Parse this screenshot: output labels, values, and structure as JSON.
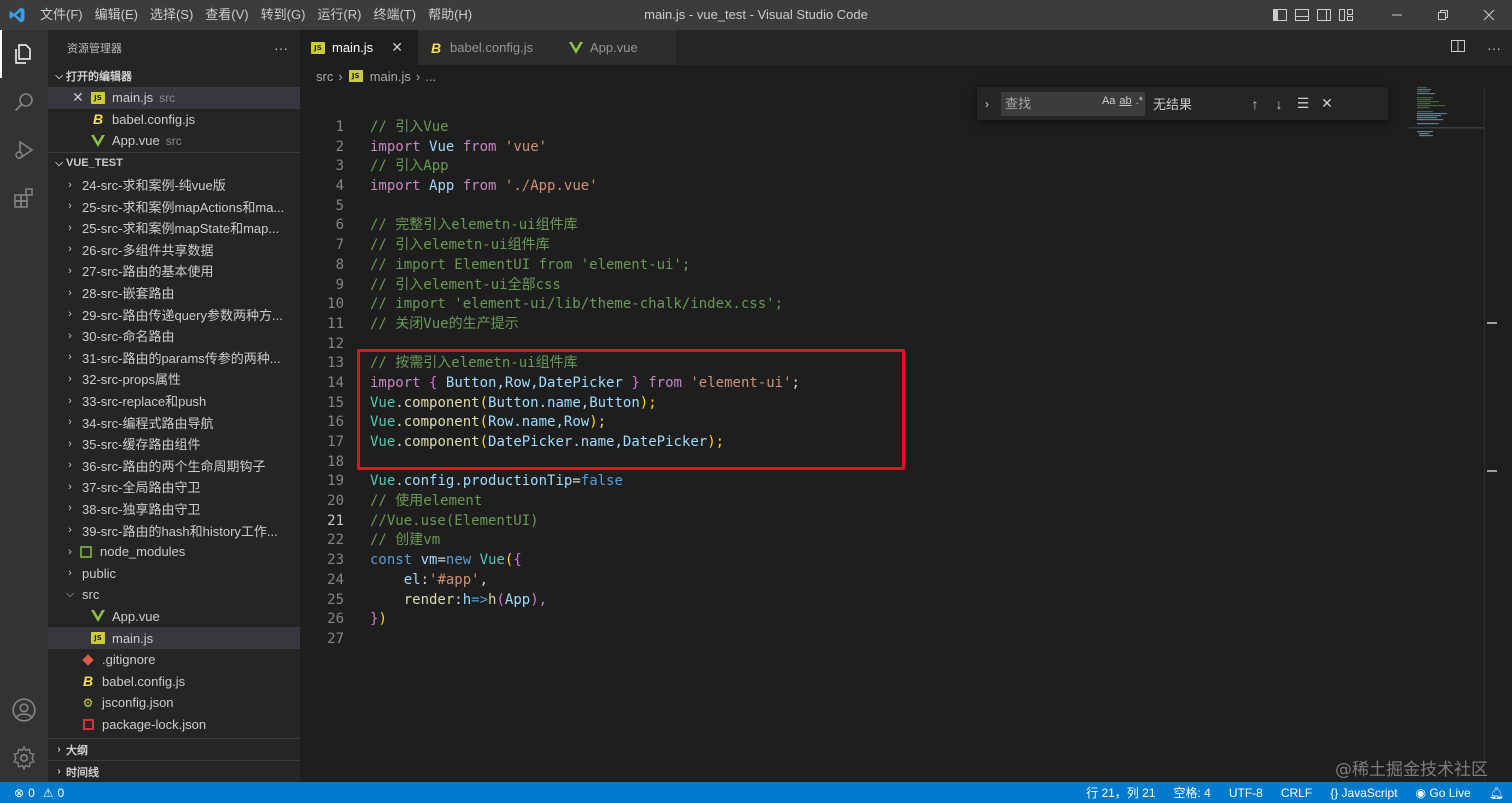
{
  "titlebar": {
    "menu": [
      "文件(F)",
      "编辑(E)",
      "选择(S)",
      "查看(V)",
      "转到(G)",
      "运行(R)",
      "终端(T)",
      "帮助(H)"
    ],
    "title": "main.js - vue_test - Visual Studio Code"
  },
  "sidebar": {
    "title": "资源管理器",
    "more": "···",
    "open_editors": {
      "header": "打开的编辑器",
      "items": [
        {
          "name": "main.js",
          "desc": "src"
        },
        {
          "name": "babel.config.js",
          "desc": ""
        },
        {
          "name": "App.vue",
          "desc": "src"
        }
      ]
    },
    "project": {
      "header": "VUE_TEST",
      "folders": [
        "24-src-求和案例-纯vue版",
        "25-src-求和案例mapActions和ma...",
        "25-src-求和案例mapState和map...",
        "26-src-多组件共享数据",
        "27-src-路由的基本使用",
        "28-src-嵌套路由",
        "29-src-路由传递query参数两种方...",
        "30-src-命名路由",
        "31-src-路由的params传参的两种...",
        "32-src-props属性",
        "33-src-replace和push",
        "34-src-编程式路由导航",
        "35-src-缓存路由组件",
        "36-src-路由的两个生命周期钩子",
        "37-src-全局路由守卫",
        "38-src-独享路由守卫",
        "39-src-路由的hash和history工作...",
        "node_modules",
        "public"
      ],
      "src_folder": "src",
      "src_files": [
        "App.vue",
        "main.js"
      ],
      "root_files": [
        ".gitignore",
        "babel.config.js",
        "jsconfig.json",
        "package-lock.json"
      ]
    },
    "outline": "大纲",
    "timeline": "时间线"
  },
  "tabs": [
    {
      "label": "main.js",
      "close": "✕"
    },
    {
      "label": "babel.config.js"
    },
    {
      "label": "App.vue"
    }
  ],
  "breadcrumb": {
    "folder": "src",
    "file": "main.js",
    "tail": "..."
  },
  "find": {
    "placeholder": "查找",
    "opt_case": "Aa",
    "opt_word": "ab",
    "opt_regex": ".*",
    "result": "无结果"
  },
  "code_lines": [
    "1",
    "2",
    "3",
    "4",
    "5",
    "6",
    "7",
    "8",
    "9",
    "10",
    "11",
    "12",
    "13",
    "14",
    "15",
    "16",
    "17",
    "18",
    "19",
    "20",
    "21",
    "22",
    "23",
    "24",
    "25",
    "26",
    "27"
  ],
  "code": {
    "l1": "// 引入Vue",
    "l2_kw": "import",
    "l2_id": "Vue",
    "l2_from": "from",
    "l2_str": "'vue'",
    "l3": "// 引入App",
    "l4_kw": "import",
    "l4_id": "App",
    "l4_from": "from",
    "l4_str": "'./App.vue'",
    "l6": "// 完整引入elemetn-ui组件库",
    "l7": "// 引入elemetn-ui组件库",
    "l8": "// import ElementUI from 'element-ui';",
    "l9": "// 引入element-ui全部css",
    "l10": "// import 'element-ui/lib/theme-chalk/index.css';",
    "l11": "// 关闭Vue的生产提示",
    "l13": "// 按需引入elemetn-ui组件库",
    "l14_kw": "import",
    "l14_ob": "{",
    "l14_ids": "Button,Row,DatePicker",
    "l14_cb": "}",
    "l14_from": "from",
    "l14_str": "'element-ui'",
    "l14_semi": ";",
    "l15_a": "Vue",
    "l15_b": ".component",
    "l15_c": "(",
    "l15_d": "Button",
    "l15_e": ".name",
    "l15_f": ",Button",
    "l15_g": ");",
    "l16_a": "Vue",
    "l16_b": ".component",
    "l16_c": "(",
    "l16_d": "Row",
    "l16_e": ".name",
    "l16_f": ",Row",
    "l16_g": ");",
    "l17_a": "Vue",
    "l17_b": ".component",
    "l17_c": "(",
    "l17_d": "DatePicker",
    "l17_e": ".name",
    "l17_f": ",DatePicker",
    "l17_g": ");",
    "l19_a": "Vue",
    "l19_b": ".config",
    "l19_c": ".productionTip",
    "l19_d": "=",
    "l19_e": "false",
    "l20": "// 使用element",
    "l21": "//Vue.use(ElementUI)",
    "l22": "// 创建vm",
    "l23_a": "const",
    "l23_b": "vm",
    "l23_c": "=",
    "l23_d": "new",
    "l23_e": "Vue",
    "l23_f": "(",
    "l23_g": "{",
    "l24_a": "el",
    "l24_b": ":",
    "l24_c": "'#app'",
    "l24_d": ",",
    "l25_a": "render",
    "l25_b": ":",
    "l25_c": "h",
    "l25_d": "=>",
    "l25_e": "h",
    "l25_f": "(",
    "l25_g": "App",
    "l25_h": "),",
    "l26_a": "}",
    "l26_b": ")"
  },
  "statusbar": {
    "errors": "0",
    "warnings": "0",
    "position": "行 21，列 21",
    "spaces": "空格: 4",
    "encoding": "UTF-8",
    "eol": "CRLF",
    "language": "JavaScript",
    "golive": "Go Live"
  },
  "watermark": "@稀土掘金技术社区",
  "colors": {
    "accent": "#007acc",
    "highlight_box": "#e81123"
  }
}
